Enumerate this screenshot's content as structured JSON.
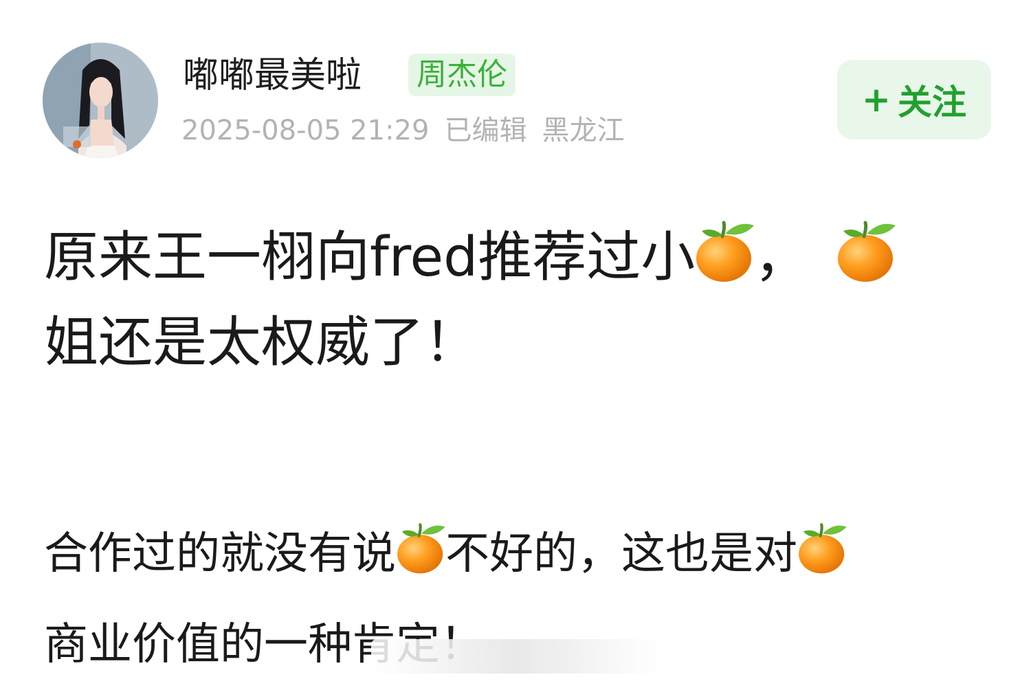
{
  "post": {
    "author": "嘟嘟最美啦",
    "tag": "周杰伦",
    "timestamp": "2025-08-05 21:29",
    "edited": "已编辑",
    "location": "黑龙江",
    "follow_label": "关注",
    "follow_plus": "+",
    "paragraph1_part1": "原来王一栩向fred推荐过小",
    "paragraph1_comma": "，",
    "paragraph1_line2": "姐还是太权威了！",
    "paragraph2_part1": "合作过的就没有说",
    "paragraph2_part2": "不好的，这也是对",
    "paragraph2_line2": "商业价值的一种肯定！"
  },
  "icons": {
    "avatar": "user-avatar-photo",
    "emoji": "tangerine-emoji"
  },
  "colors": {
    "tag_text": "#3ab13a",
    "tag_bg": "#e6f6e6",
    "follow_text": "#22a02f",
    "follow_bg": "#e8f7ea",
    "meta_text": "#b3b3b3"
  }
}
